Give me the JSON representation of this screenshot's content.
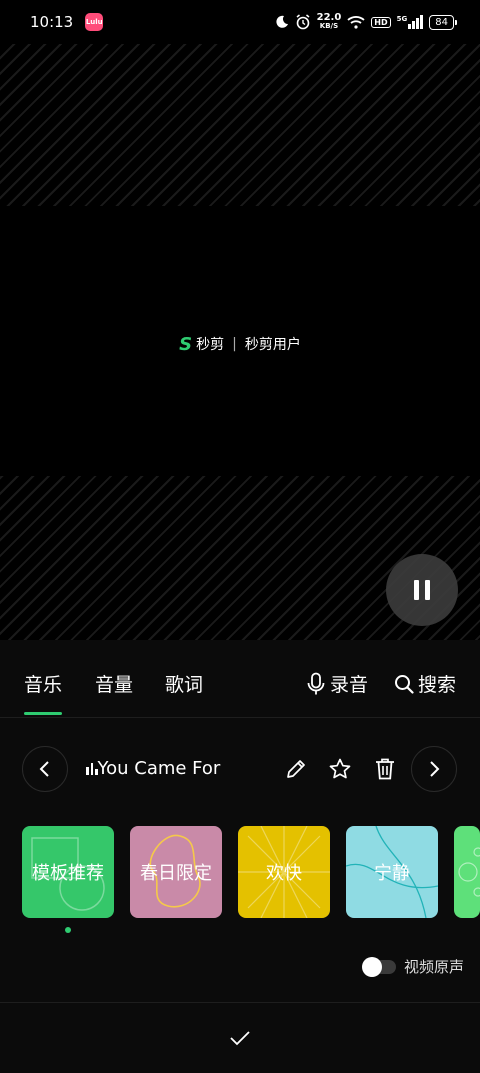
{
  "status_bar": {
    "time": "10:13",
    "app_badge": "Lulu",
    "net_speed": "22.0",
    "net_unit": "KB/S",
    "hd": "HD",
    "signal": "5G",
    "battery": "84"
  },
  "preview": {
    "watermark_brand": "秒剪",
    "watermark_user": "秒剪用户"
  },
  "tabs": {
    "music": "音乐",
    "volume": "音量",
    "lyrics": "歌词",
    "record": "录音",
    "search": "搜索",
    "active": "music"
  },
  "track": {
    "title": "You Came For"
  },
  "categories": [
    {
      "label": "模板推荐",
      "color": "#35c76a"
    },
    {
      "label": "春日限定",
      "color": "#c98aa8"
    },
    {
      "label": "欢快",
      "color": "#e4c100"
    },
    {
      "label": "宁静",
      "color": "#8fdbe3"
    },
    {
      "label": "",
      "color": "#5ee07a"
    }
  ],
  "original_sound": {
    "label": "视频原声",
    "enabled": false
  },
  "colors": {
    "accent": "#2fcc71"
  }
}
